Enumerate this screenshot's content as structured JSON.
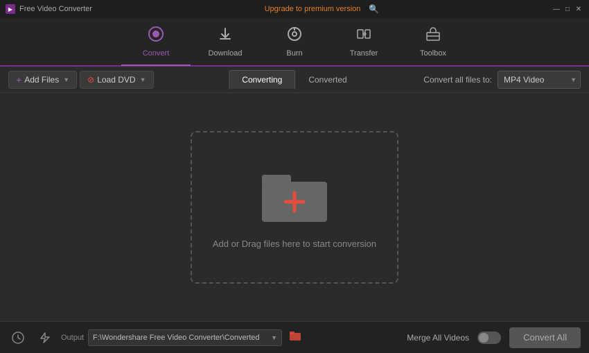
{
  "titleBar": {
    "appName": "Free Video Converter",
    "upgradeText": "Upgrade to premium version",
    "searchIcon": "🔍",
    "minimizeIcon": "—",
    "maximizeIcon": "□",
    "closeIcon": "✕"
  },
  "nav": {
    "items": [
      {
        "id": "convert",
        "label": "Convert",
        "icon": "◎",
        "active": true
      },
      {
        "id": "download",
        "label": "Download",
        "icon": "⬇",
        "active": false
      },
      {
        "id": "burn",
        "label": "Burn",
        "icon": "⊙",
        "active": false
      },
      {
        "id": "transfer",
        "label": "Transfer",
        "icon": "⇌",
        "active": false
      },
      {
        "id": "toolbox",
        "label": "Toolbox",
        "icon": "⊞",
        "active": false
      }
    ]
  },
  "toolbar": {
    "addFilesLabel": "Add Files",
    "loadDvdLabel": "Load DVD",
    "convertAllFilesLabel": "Convert all files to:",
    "formatValue": "MP4 Video"
  },
  "tabs": {
    "converting": "Converting",
    "converted": "Converted",
    "activeTab": "converting"
  },
  "dropZone": {
    "text": "Add or Drag files here to start conversion"
  },
  "bottomBar": {
    "outputLabel": "Output",
    "outputPath": "F:\\Wondershare Free Video Converter\\Converted",
    "mergeLabel": "Merge All Videos",
    "convertAllLabel": "Convert All"
  }
}
